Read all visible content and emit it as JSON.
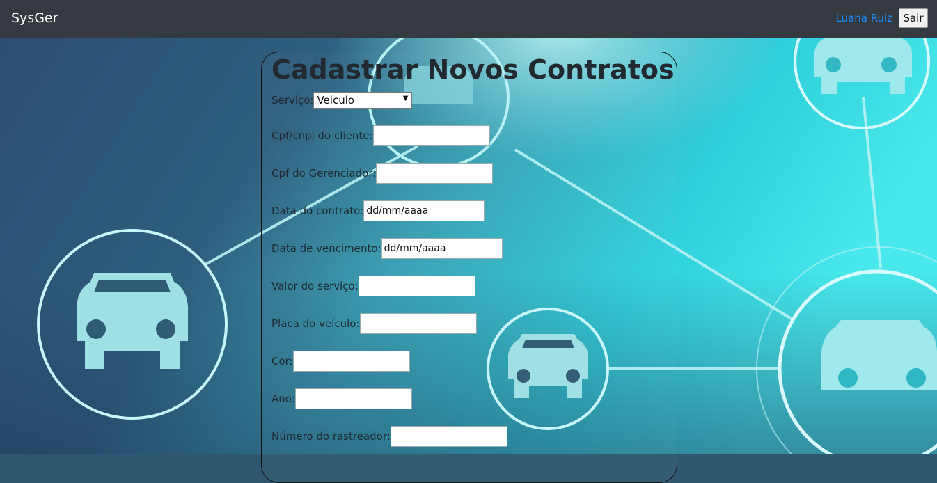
{
  "navbar": {
    "brand": "SysGer",
    "user_name": "Luana Ruiz",
    "logout_label": "Sair"
  },
  "form": {
    "title": "Cadastrar Novos Contratos",
    "service_label": "Serviço:",
    "service_selected": "Veiculo",
    "cpf_cliente_label": "Cpf/cnpj do cliente:",
    "cpf_gerenciador_label": "Cpf do Gerenciador:",
    "data_contrato_label": "Data do contrato:",
    "data_contrato_placeholder": "dd/mm/aaaa",
    "data_vencimento_label": "Data de vencimento:",
    "data_vencimento_placeholder": "dd/mm/aaaa",
    "valor_label": "Valor do serviço:",
    "placa_label": "Placa do veículo:",
    "cor_label": "Cor:",
    "ano_label": "Ano:",
    "rastreador_label": "Número do rastreador:"
  },
  "colors": {
    "navbar_bg": "#343a40",
    "link": "#1a8cff",
    "background_teal": "#2ad4dc",
    "background_navy": "#2f4a6e"
  }
}
